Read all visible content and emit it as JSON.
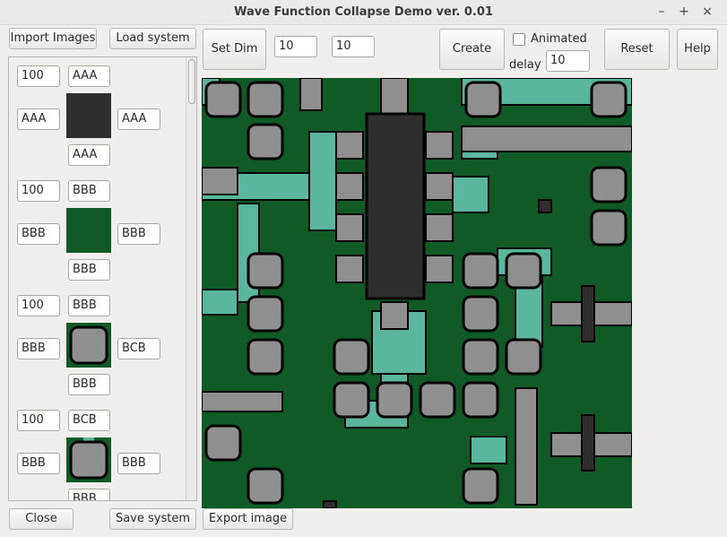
{
  "window": {
    "title": "Wave Function Collapse Demo ver. 0.01",
    "controls": {
      "minimize": "–",
      "maximize": "+",
      "close": "×"
    }
  },
  "toolbar": {
    "import_images": "Import Images",
    "load_system": "Load system",
    "set_dim": "Set Dim",
    "dim_x": "10",
    "dim_y": "10",
    "create": "Create",
    "animated": "Animated",
    "animated_checked": false,
    "delay_label": "delay",
    "delay_value": "10",
    "reset": "Reset",
    "help": "Help"
  },
  "bottom": {
    "close": "Close",
    "save_system": "Save system",
    "export_image": "Export image"
  },
  "tiles": [
    {
      "weight": "100",
      "top": "AAA",
      "left": "AAA",
      "right": "AAA",
      "bottom": "AAA",
      "image": "dark-gray-square"
    },
    {
      "weight": "100",
      "top": "BBB",
      "left": "BBB",
      "right": "BBB",
      "bottom": "BBB",
      "image": "green-square"
    },
    {
      "weight": "100",
      "top": "BBB",
      "left": "BBB",
      "right": "BCB",
      "bottom": "BBB",
      "image": "gray-pad-on-green"
    },
    {
      "weight": "100",
      "top": "BCB",
      "left": "BBB",
      "right": "BBB",
      "bottom": "BBB",
      "image": "gray-pad-with-trace"
    }
  ],
  "colors": {
    "board": "#0f5a27",
    "trace": "#5ab79d",
    "pad": "#8f8f8f",
    "chip": "#2e2e2e",
    "outline": "#000000"
  }
}
